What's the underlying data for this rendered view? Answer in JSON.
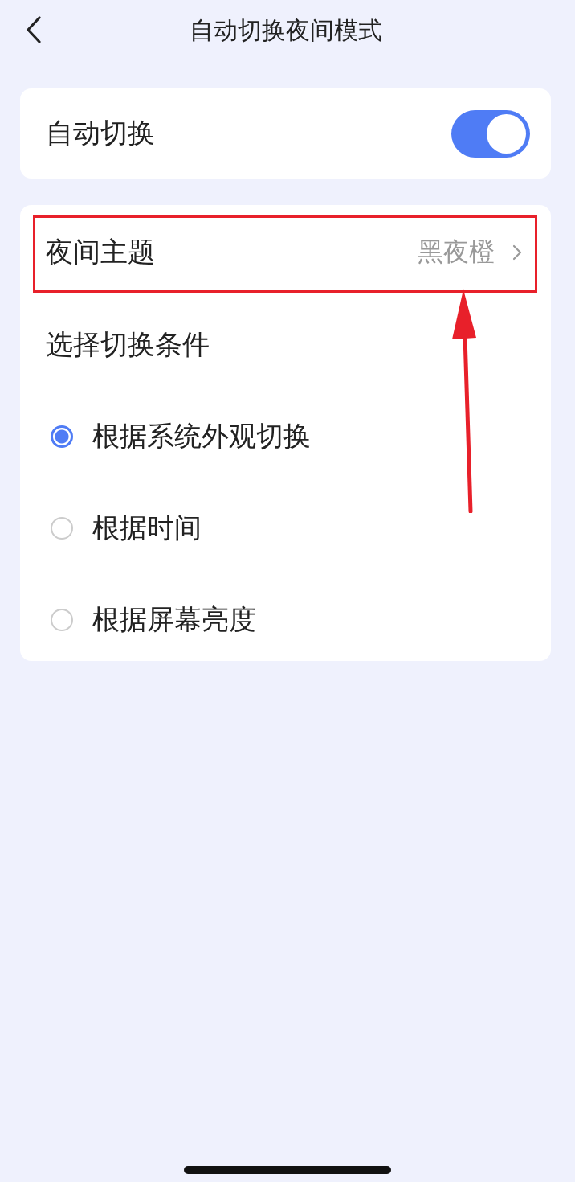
{
  "header": {
    "title": "自动切换夜间模式"
  },
  "auto_switch": {
    "label": "自动切换",
    "on": true
  },
  "night_theme": {
    "label": "夜间主题",
    "value": "黑夜橙"
  },
  "conditions": {
    "title": "选择切换条件",
    "options": [
      {
        "label": "根据系统外观切换",
        "selected": true
      },
      {
        "label": "根据时间",
        "selected": false
      },
      {
        "label": "根据屏幕亮度",
        "selected": false
      }
    ]
  },
  "annotations": {
    "highlight_box": true,
    "arrow": true
  }
}
